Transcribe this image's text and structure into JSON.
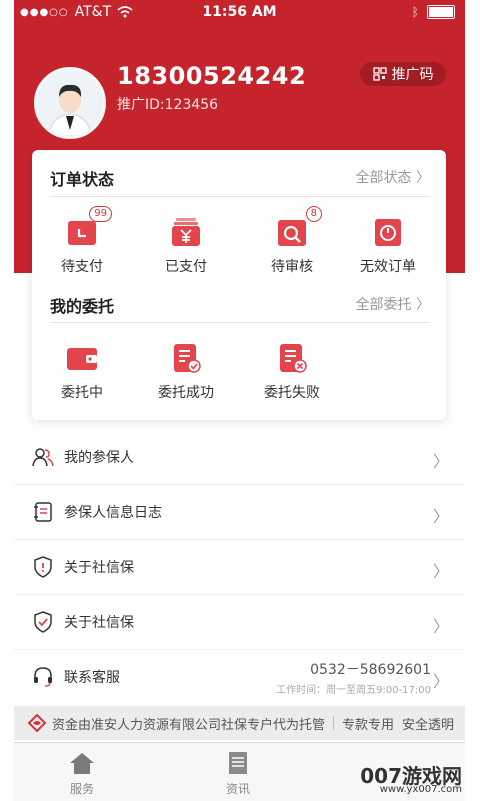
{
  "status_bar": {
    "carrier": "AT&T",
    "signal": "●●●○○",
    "time": "11:56 AM"
  },
  "profile": {
    "phone": "18300524242",
    "promo_id": "推广ID:123456",
    "promo_button": "推广码"
  },
  "orders": {
    "title": "订单状态",
    "all_link": "全部状态 〉",
    "items": [
      {
        "label": "待支付",
        "badge": "99",
        "icon": "wallet-clock-icon"
      },
      {
        "label": "已支付",
        "badge": "",
        "icon": "yuan-icon"
      },
      {
        "label": "待审核",
        "badge": "8",
        "icon": "search-doc-icon"
      },
      {
        "label": "无效订单",
        "badge": "",
        "icon": "invalid-order-icon"
      }
    ]
  },
  "entrust": {
    "title": "我的委托",
    "all_link": "全部委托 〉",
    "items": [
      {
        "label": "委托中",
        "icon": "wallet-icon"
      },
      {
        "label": "委托成功",
        "icon": "doc-check-icon"
      },
      {
        "label": "委托失败",
        "icon": "doc-fail-icon"
      }
    ]
  },
  "menu": [
    {
      "label": "我的参保人",
      "icon": "people-icon"
    },
    {
      "label": "参保人信息日志",
      "icon": "log-icon"
    },
    {
      "label": "关于社信保",
      "icon": "shield-alert-icon"
    },
    {
      "label": "关于社信保",
      "icon": "shield-check-icon"
    },
    {
      "label": "联系客服",
      "icon": "headset-icon",
      "value": "0532－58692601",
      "sub": "工作时间：周一至周五9:00-17:00"
    }
  ],
  "footer_note": {
    "text": "资金由准安人力资源有限公司社保专户代为托管",
    "tag1": "专款专用",
    "tag2": "安全透明"
  },
  "tabs": [
    {
      "label": "服务",
      "icon": "home-icon"
    },
    {
      "label": "资讯",
      "icon": "news-icon"
    }
  ],
  "watermark": {
    "main": "007游戏网",
    "sub": "www.yx007.com"
  },
  "colors": {
    "brand": "#c6242d",
    "accent": "#e2454c"
  }
}
